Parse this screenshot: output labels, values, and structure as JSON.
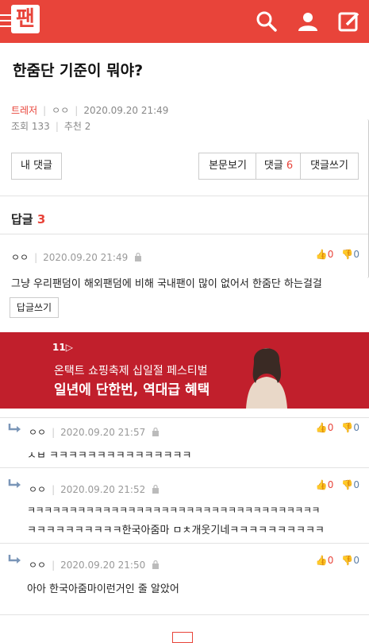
{
  "header": {
    "logo_text": "팬",
    "icons": [
      "menu-icon",
      "search-icon",
      "user-icon",
      "write-icon"
    ],
    "brand_color": "#e8443a"
  },
  "post": {
    "title": "한줌단 기준이 뭐야?",
    "author": "트레저",
    "nickname": "ㅇㅇ",
    "datetime": "2020.09.20 21:49",
    "views_label": "조회 133",
    "recommend_label": "추천 2"
  },
  "buttons": {
    "my_comments": "내 댓글",
    "view_post": "본문보기",
    "comments_label": "댓글",
    "comments_count": "6",
    "write_comment": "댓글쓰기"
  },
  "replies_section": {
    "label": "답글",
    "count": "3"
  },
  "comment_main": {
    "nick": "ㅇㅇ",
    "datetime": "2020.09.20 21:49",
    "up": "0",
    "down": "0",
    "text": "그냥 우리팬덤이 해외팬덤에 비해 국내팬이 많이 없어서 한줌단 하는걸걸",
    "reply_button": "답글쓰기"
  },
  "ad": {
    "brand": "11▷",
    "line1": "온택트 쇼핑축제 십일절 페스티벌",
    "line2": "일년에 단한번, 역대급 혜택"
  },
  "replies": [
    {
      "nick": "ㅇㅇ",
      "datetime": "2020.09.20 21:57",
      "up": "0",
      "down": "0",
      "text": "ㅅㅂ ㅋㅋㅋㅋㅋㅋㅋㅋㅋㅋㅋㅋㅋㅋㅋ",
      "text2": ""
    },
    {
      "nick": "ㅇㅇ",
      "datetime": "2020.09.20 21:52",
      "up": "0",
      "down": "0",
      "text": "ㅋㅋㅋㅋㅋㅋㅋㅋㅋㅋㅋㅋㅋㅋㅋㅋㅋㅋㅋㅋㅋㅋㅋㅋㅋㅋㅋㅋㅋㅋㅋㅋㅋㅋㅋ",
      "text2": "ㅋㅋㅋㅋㅋㅋㅋㅋㅋㅋ한국아줌마 ㅁㅊ개웃기네ㅋㅋㅋㅋㅋㅋㅋㅋㅋㅋ"
    },
    {
      "nick": "ㅇㅇ",
      "datetime": "2020.09.20 21:50",
      "up": "0",
      "down": "0",
      "text": "아아 한국아줌마이런거인 줄 알았어",
      "text2": ""
    }
  ]
}
